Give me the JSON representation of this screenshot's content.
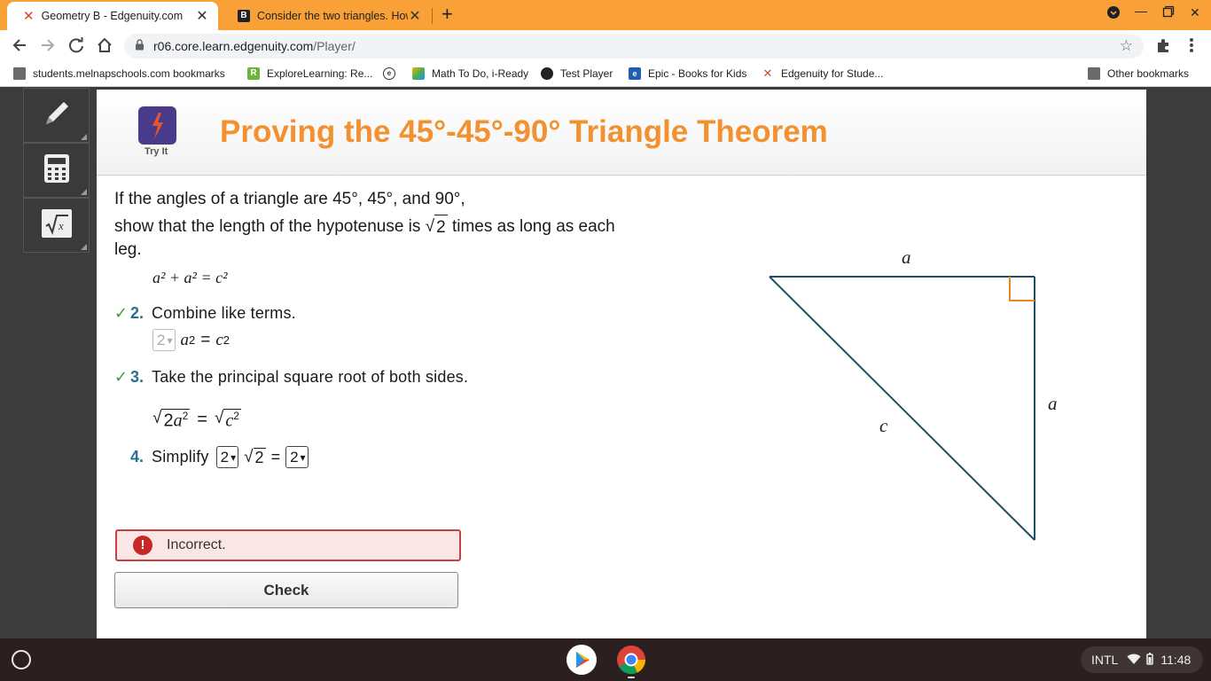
{
  "browser": {
    "tabs": [
      {
        "title": "Geometry B - Edgenuity.com",
        "active": true
      },
      {
        "title": "Consider the two triangles. How",
        "active": false
      }
    ],
    "close_glyph": "✕",
    "new_tab_glyph": "+",
    "url_host": "r06.core.learn.edgenuity.com",
    "url_path": "/Player/",
    "bookmarks": [
      "students.melnapschools.com bookmarks",
      "ExploreLearning: Re...",
      "Math To Do, i-Ready",
      "Test Player",
      "Epic - Books for Kids",
      "Edgenuity for Stude...",
      "Other bookmarks"
    ]
  },
  "header": {
    "tryit_label": "Try It",
    "title": "Proving the 45°-45°-90° Triangle Theorem"
  },
  "prompt": {
    "line1": "If the angles of a triangle are 45°, 45°, and 90°,",
    "line2_pre": "show that the length of the hypotenuse is",
    "radicand": "2",
    "line2_post": "times as long as each",
    "line3": "leg."
  },
  "equation1": "a² + a² = c²",
  "steps": [
    {
      "number": "2.",
      "text": "Combine like terms.",
      "checked": true
    },
    {
      "number": "3.",
      "text": "Take the principal square root of both sides.",
      "checked": true
    },
    {
      "number": "4.",
      "text": "Simplify",
      "checked": false
    }
  ],
  "step2_eq": {
    "select_value": "2",
    "lhs": "a",
    "exp": "2",
    "eq": "=",
    "rhs": "c",
    "rhs_exp": "2"
  },
  "step3_eq": {
    "lhs_coef": "2",
    "lhs_var": "a",
    "lhs_exp": "2",
    "eq": "=",
    "rhs_var": "c",
    "rhs_exp": "2"
  },
  "step4": {
    "select1_value": "2",
    "radicand": "2",
    "eq": "=",
    "select2_value": "2"
  },
  "feedback": {
    "message": "Incorrect.",
    "icon": "!"
  },
  "check_button": "Check",
  "diagram": {
    "top_label": "a",
    "right_label": "a",
    "hyp_label": "c"
  },
  "colors": {
    "title_orange": "#f1912f",
    "step_blue": "#2a6f8c",
    "check_green": "#3a9e3a",
    "error_red": "#c62828",
    "triangle": "#1f4e63",
    "right_angle": "#e8891e"
  },
  "shelf": {
    "ime": "INTL",
    "time": "11:48"
  }
}
